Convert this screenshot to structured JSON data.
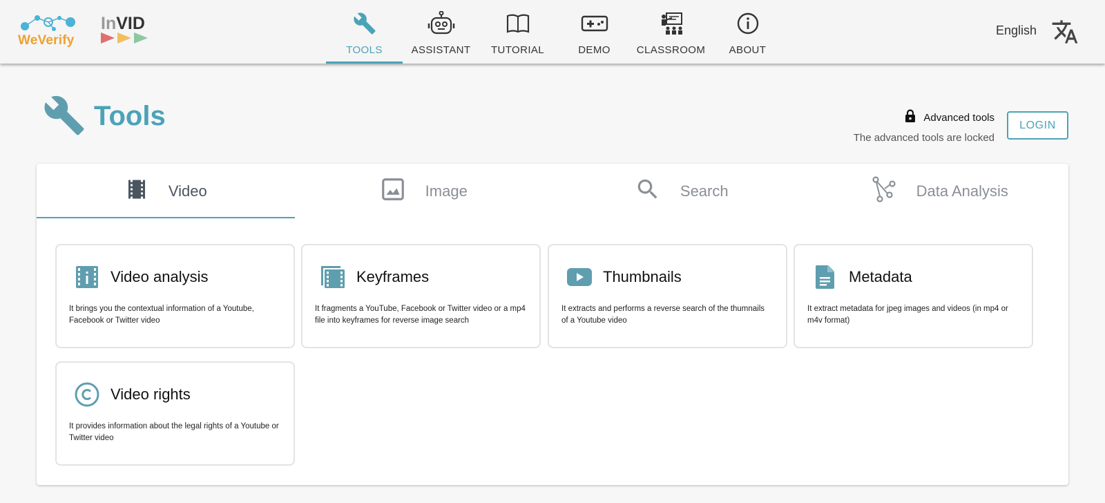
{
  "header": {
    "logo_weverify": "WeVerify",
    "logo_invid": "VID",
    "logo_invid_prefix": "In",
    "nav": [
      {
        "label": "TOOLS",
        "icon": "wrench-icon",
        "active": true
      },
      {
        "label": "ASSISTANT",
        "icon": "robot-icon",
        "active": false
      },
      {
        "label": "TUTORIAL",
        "icon": "book-icon",
        "active": false
      },
      {
        "label": "DEMO",
        "icon": "gamepad-icon",
        "active": false
      },
      {
        "label": "CLASSROOM",
        "icon": "classroom-icon",
        "active": false
      },
      {
        "label": "ABOUT",
        "icon": "info-icon",
        "active": false
      }
    ],
    "language": "English"
  },
  "page": {
    "title": "Tools",
    "advanced_title": "Advanced tools",
    "advanced_subtitle": "The advanced tools are locked",
    "login_label": "LOGIN"
  },
  "tabs": [
    {
      "label": "Video",
      "icon": "film-icon",
      "active": true
    },
    {
      "label": "Image",
      "icon": "image-icon",
      "active": false
    },
    {
      "label": "Search",
      "icon": "search-icon",
      "active": false
    },
    {
      "label": "Data Analysis",
      "icon": "graph-icon",
      "active": false
    }
  ],
  "tools": [
    {
      "title": "Video analysis",
      "icon": "video-analysis-icon",
      "description": "It brings you the contextual information of a Youtube, Facebook or Twitter video"
    },
    {
      "title": "Keyframes",
      "icon": "keyframes-icon",
      "description": "It fragments a YouTube, Facebook or Twitter video or a mp4 file into keyframes for reverse image search"
    },
    {
      "title": "Thumbnails",
      "icon": "youtube-icon",
      "description": "It extracts and performs a reverse search of the thumnails of a Youtube video"
    },
    {
      "title": "Metadata",
      "icon": "document-icon",
      "description": "It extract metadata for jpeg images and videos (in mp4 or m4v format)"
    },
    {
      "title": "Video rights",
      "icon": "copyright-icon",
      "description": "It provides information about the legal rights of a Youtube or Twitter video"
    }
  ],
  "colors": {
    "accent": "#4ba3b8",
    "brand_orange": "#f0a030",
    "icon_teal": "#5f9eaf"
  }
}
